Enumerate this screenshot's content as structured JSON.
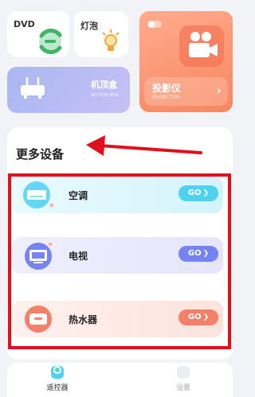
{
  "top_cards": {
    "dvd": {
      "label": "DVD"
    },
    "bulb": {
      "label": "灯泡"
    },
    "set_top_box": {
      "label": "机顶盒",
      "sublabel": "SET-TOP BOX"
    },
    "projector": {
      "label": "投影仪",
      "sublabel": "PROJECTOR",
      "arrow": "›"
    }
  },
  "more_devices": {
    "title": "更多设备",
    "items": [
      {
        "label": "空调",
        "icon": "air-conditioner-icon",
        "action": "GO",
        "color": "#4fd1f0"
      },
      {
        "label": "电视",
        "icon": "tv-icon",
        "action": "GO",
        "color": "#7683f2"
      },
      {
        "label": "热水器",
        "icon": "water-heater-icon",
        "action": "GO",
        "color": "#f5806a"
      }
    ]
  },
  "tabbar": {
    "tabs": [
      {
        "label": "遥控器",
        "icon": "remote-icon",
        "active": true
      },
      {
        "label": "设置",
        "icon": "settings-icon",
        "active": false
      }
    ]
  },
  "annotation": {
    "color": "#e0101d"
  }
}
